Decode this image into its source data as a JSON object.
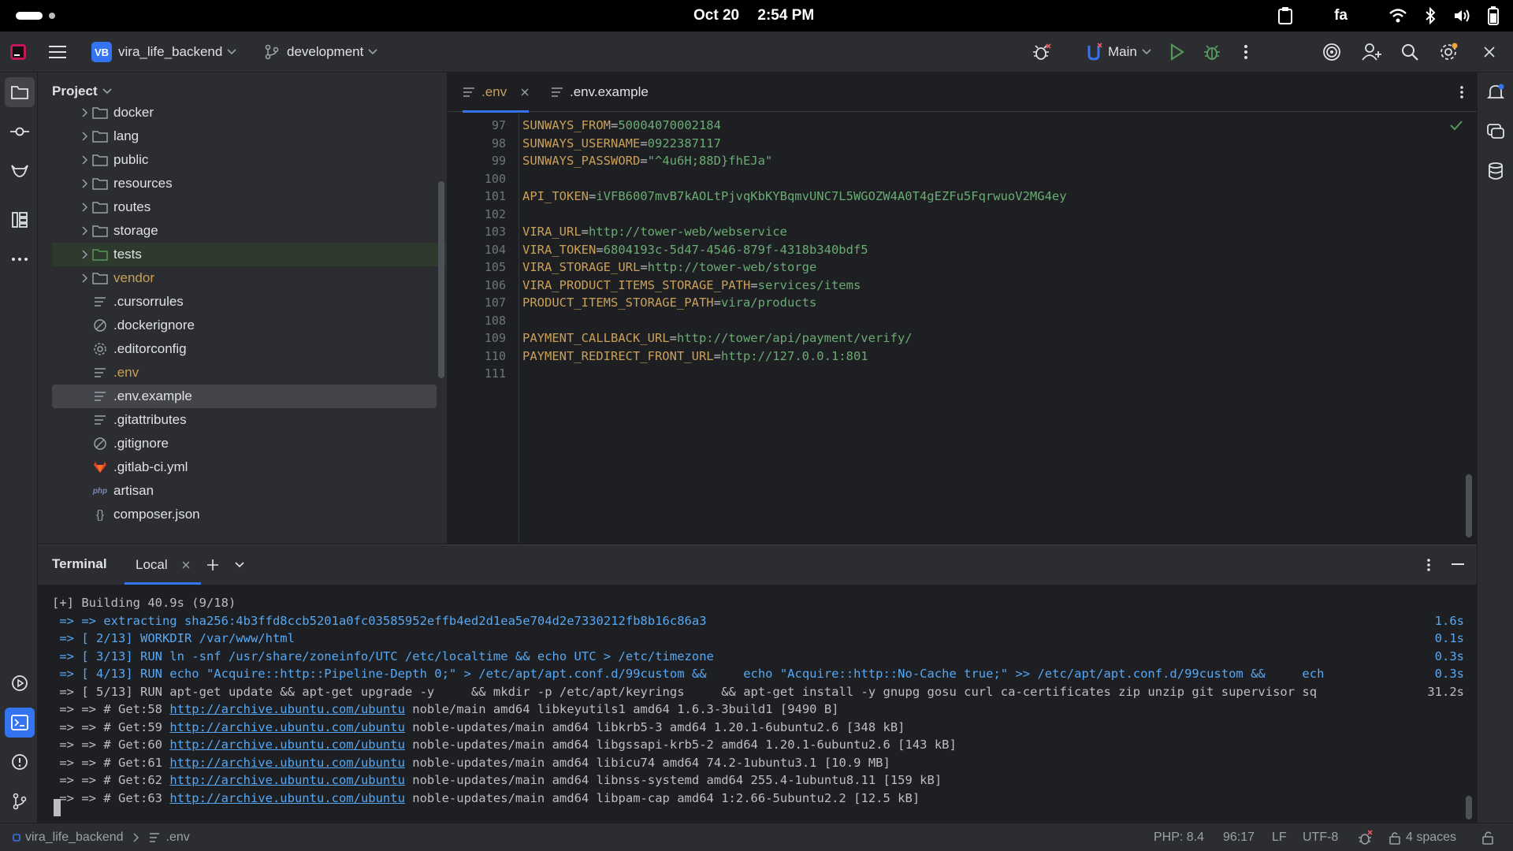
{
  "status_bar": {
    "date": "Oct 20",
    "time": "2:54 PM",
    "keyboard_lang": "fa"
  },
  "title_bar": {
    "project_badge": "VB",
    "project_name": "vira_life_backend",
    "branch": "development",
    "run_config": "Main"
  },
  "project_panel": {
    "title": "Project",
    "items": [
      {
        "label": "docker",
        "type": "folder",
        "icon": "folder-icon"
      },
      {
        "label": "lang",
        "type": "folder",
        "icon": "folder-icon"
      },
      {
        "label": "public",
        "type": "folder",
        "icon": "folder-icon"
      },
      {
        "label": "resources",
        "type": "folder",
        "icon": "folder-icon"
      },
      {
        "label": "routes",
        "type": "folder",
        "icon": "folder-icon"
      },
      {
        "label": "storage",
        "type": "folder",
        "icon": "folder-icon"
      },
      {
        "label": "tests",
        "type": "folder",
        "icon": "folder-test-icon"
      },
      {
        "label": "vendor",
        "type": "folder",
        "icon": "folder-icon"
      },
      {
        "label": ".cursorrules",
        "type": "file",
        "icon": "text-file-icon"
      },
      {
        "label": ".dockerignore",
        "type": "file",
        "icon": "ignore-file-icon"
      },
      {
        "label": ".editorconfig",
        "type": "file",
        "icon": "gear-file-icon"
      },
      {
        "label": ".env",
        "type": "file",
        "icon": "text-file-icon"
      },
      {
        "label": ".env.example",
        "type": "file",
        "icon": "text-file-icon"
      },
      {
        "label": ".gitattributes",
        "type": "file",
        "icon": "text-file-icon"
      },
      {
        "label": ".gitignore",
        "type": "file",
        "icon": "ignore-file-icon"
      },
      {
        "label": ".gitlab-ci.yml",
        "type": "file",
        "icon": "gitlab-icon"
      },
      {
        "label": "artisan",
        "type": "file",
        "icon": "php-icon"
      },
      {
        "label": "composer.json",
        "type": "file",
        "icon": "json-file-icon"
      }
    ]
  },
  "editor": {
    "tabs": [
      {
        "label": ".env",
        "active": true
      },
      {
        "label": ".env.example",
        "active": false
      }
    ],
    "lines": [
      {
        "num": "97",
        "key": "SUNWAYS_FROM",
        "value": "50004070002184"
      },
      {
        "num": "98",
        "key": "SUNWAYS_USERNAME",
        "value": "0922387117"
      },
      {
        "num": "99",
        "key": "SUNWAYS_PASSWORD",
        "value": "\"^4u6H;88D}fhEJa\""
      },
      {
        "num": "100",
        "key": "",
        "value": ""
      },
      {
        "num": "101",
        "key": "API_TOKEN",
        "value": "iVFB6007mvB7kAOLtPjvqKbKYBqmvUNC7L5WGOZW4A0T4gEZFu5FqrwuoV2MG4ey"
      },
      {
        "num": "102",
        "key": "",
        "value": ""
      },
      {
        "num": "103",
        "key": "VIRA_URL",
        "value": "http://tower-web/webservice"
      },
      {
        "num": "104",
        "key": "VIRA_TOKEN",
        "value": "6804193c-5d47-4546-879f-4318b340bdf5"
      },
      {
        "num": "105",
        "key": "VIRA_STORAGE_URL",
        "value": "http://tower-web/storge"
      },
      {
        "num": "106",
        "key": "VIRA_PRODUCT_ITEMS_STORAGE_PATH",
        "value": "services/items"
      },
      {
        "num": "107",
        "key": "PRODUCT_ITEMS_STORAGE_PATH",
        "value": "vira/products"
      },
      {
        "num": "108",
        "key": "",
        "value": ""
      },
      {
        "num": "109",
        "key": "PAYMENT_CALLBACK_URL",
        "value": "http://tower/api/payment/verify/"
      },
      {
        "num": "110",
        "key": "PAYMENT_REDIRECT_FRONT_URL",
        "value": "http://127.0.0.1:801"
      },
      {
        "num": "111",
        "key": "",
        "value": ""
      }
    ]
  },
  "terminal": {
    "title": "Terminal",
    "tab": "Local",
    "lines": [
      {
        "text": "[+] Building 40.9s (9/18)",
        "time": "",
        "color": "white"
      },
      {
        "text": " => => extracting sha256:4b3ffd8ccb5201a0fc03585952effb4ed2d1ea5e704d2e7330212fb8b16c86a3",
        "time": "1.6s",
        "color": "blue"
      },
      {
        "text": " => [ 2/13] WORKDIR /var/www/html",
        "time": "0.1s",
        "color": "blue"
      },
      {
        "text": " => [ 3/13] RUN ln -snf /usr/share/zoneinfo/UTC /etc/localtime && echo UTC > /etc/timezone",
        "time": "0.3s",
        "color": "blue"
      },
      {
        "text": " => [ 4/13] RUN echo \"Acquire::http::Pipeline-Depth 0;\" > /etc/apt/apt.conf.d/99custom &&     echo \"Acquire::http::No-Cache true;\" >> /etc/apt/apt.conf.d/99custom &&     ech",
        "time": "0.3s",
        "color": "blue"
      },
      {
        "text": " => [ 5/13] RUN apt-get update && apt-get upgrade -y     && mkdir -p /etc/apt/keyrings     && apt-get install -y gnupg gosu curl ca-certificates zip unzip git supervisor sq",
        "time": "31.2s",
        "color": "white"
      },
      {
        "text": " => => # Get:58 ",
        "link": "http://archive.ubuntu.com/ubuntu",
        "rest": " noble/main amd64 libkeyutils1 amd64 1.6.3-3build1 [9490 B]",
        "time": "",
        "color": "white"
      },
      {
        "text": " => => # Get:59 ",
        "link": "http://archive.ubuntu.com/ubuntu",
        "rest": " noble-updates/main amd64 libkrb5-3 amd64 1.20.1-6ubuntu2.6 [348 kB]",
        "time": "",
        "color": "white"
      },
      {
        "text": " => => # Get:60 ",
        "link": "http://archive.ubuntu.com/ubuntu",
        "rest": " noble-updates/main amd64 libgssapi-krb5-2 amd64 1.20.1-6ubuntu2.6 [143 kB]",
        "time": "",
        "color": "white"
      },
      {
        "text": " => => # Get:61 ",
        "link": "http://archive.ubuntu.com/ubuntu",
        "rest": " noble-updates/main amd64 libicu74 amd64 74.2-1ubuntu3.1 [10.9 MB]",
        "time": "",
        "color": "white"
      },
      {
        "text": " => => # Get:62 ",
        "link": "http://archive.ubuntu.com/ubuntu",
        "rest": " noble-updates/main amd64 libnss-systemd amd64 255.4-1ubuntu8.11 [159 kB]",
        "time": "",
        "color": "white"
      },
      {
        "text": " => => # Get:63 ",
        "link": "http://archive.ubuntu.com/ubuntu",
        "rest": " noble-updates/main amd64 libpam-cap amd64 1:2.66-5ubuntu2.2 [12.5 kB]",
        "time": "",
        "color": "white"
      }
    ]
  },
  "bottom_bar": {
    "breadcrumb_project": "vira_life_backend",
    "breadcrumb_file": ".env",
    "php_version": "PHP: 8.4",
    "cursor_pos": "96:17",
    "line_sep": "LF",
    "encoding": "UTF-8",
    "indent": "4 spaces"
  },
  "colors": {
    "accent": "#3574f0",
    "env_key": "#c9a05a",
    "env_value": "#6aab73",
    "terminal_blue": "#56a8f5"
  }
}
